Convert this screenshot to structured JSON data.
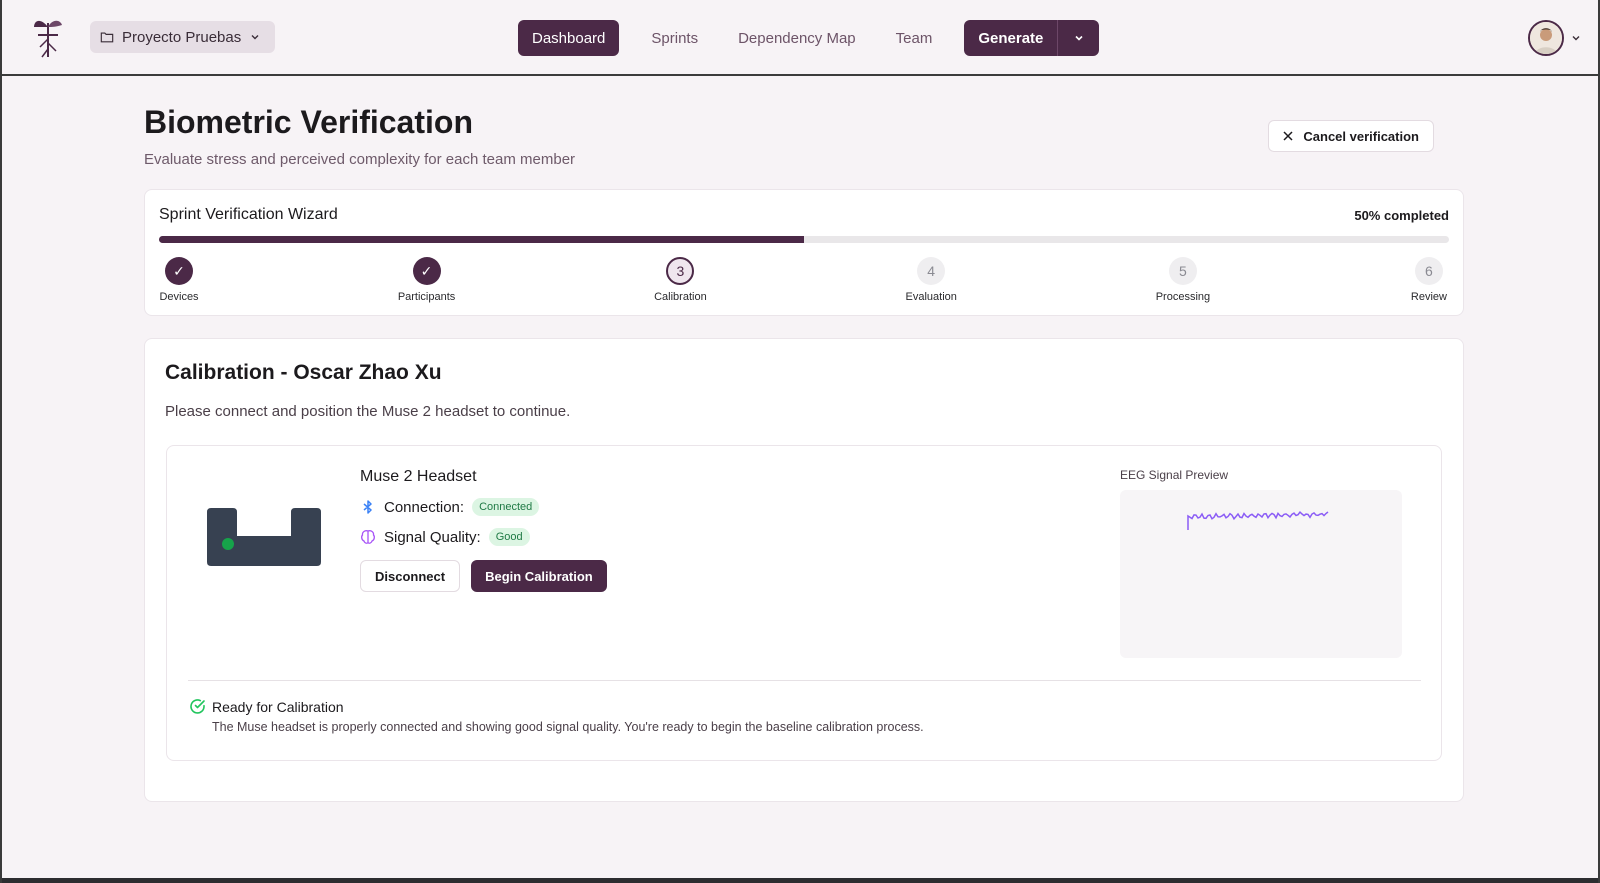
{
  "header": {
    "project": "Proyecto Pruebas",
    "nav": [
      "Dashboard",
      "Sprints",
      "Dependency Map",
      "Team"
    ],
    "generate_label": "Generate"
  },
  "page": {
    "title": "Biometric Verification",
    "subtitle": "Evaluate stress and perceived complexity for each team member",
    "cancel_label": "Cancel verification"
  },
  "wizard": {
    "title": "Sprint Verification Wizard",
    "progress_text": "50% completed",
    "progress": 0.5,
    "steps": [
      {
        "marker": "✓",
        "label": "Devices",
        "state": "done"
      },
      {
        "marker": "✓",
        "label": "Participants",
        "state": "done"
      },
      {
        "marker": "3",
        "label": "Calibration",
        "state": "current"
      },
      {
        "marker": "4",
        "label": "Evaluation",
        "state": "pending"
      },
      {
        "marker": "5",
        "label": "Processing",
        "state": "pending"
      },
      {
        "marker": "6",
        "label": "Review",
        "state": "pending"
      }
    ]
  },
  "calibration": {
    "title": "Calibration - Oscar Zhao Xu",
    "description": "Please connect and position the Muse 2 headset to continue.",
    "device_name": "Muse 2 Headset",
    "connection_label": "Connection:",
    "connection_status": "Connected",
    "signal_label": "Signal Quality:",
    "signal_status": "Good",
    "disconnect_label": "Disconnect",
    "begin_label": "Begin Calibration",
    "eeg_label": "EEG Signal Preview",
    "ready_title": "Ready for Calibration",
    "ready_text": "The Muse headset is properly connected and showing good signal quality. You're ready to begin the baseline calibration process."
  },
  "colors": {
    "brand": "#4b2947",
    "eeg_line": "#8b5cf6",
    "success": "#22c55e",
    "bluetooth": "#3b82f6"
  }
}
